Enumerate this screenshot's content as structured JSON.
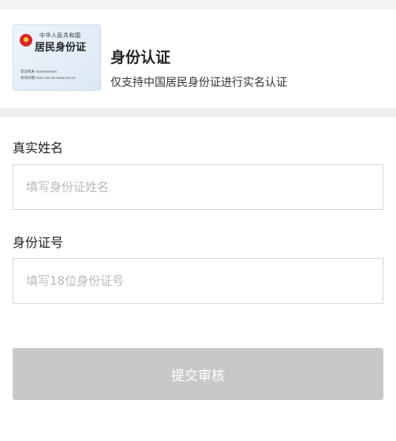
{
  "id_card": {
    "small_title": "中华人民共和国",
    "big_title": "居民身份证",
    "line1": "签证机关 xxxxxxxxxx",
    "line2": "有效日期 xxxx.xx.xx-xxxx.xx.xx"
  },
  "header": {
    "title": "身份认证",
    "subtitle": "仅支持中国居民身份证进行实名认证"
  },
  "form": {
    "name_label": "真实姓名",
    "name_placeholder": "填写身份证姓名",
    "name_value": "",
    "id_label": "身份证号",
    "id_placeholder": "填写18位身份证号",
    "id_value": ""
  },
  "submit": {
    "label": "提交审核",
    "enabled": false
  },
  "colors": {
    "button_disabled": "#c8c8c8",
    "emblem_red": "#d7262a"
  }
}
